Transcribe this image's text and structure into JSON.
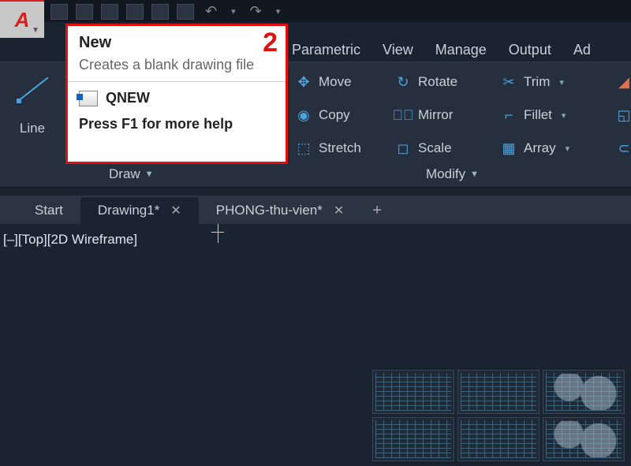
{
  "app": {
    "logo_letter": "A"
  },
  "menu": {
    "parametric": "Parametric",
    "view": "View",
    "manage": "Manage",
    "output": "Output",
    "addins": "Ad"
  },
  "tooltip": {
    "title": "New",
    "desc": "Creates a blank drawing file",
    "cmd": "QNEW",
    "help": "Press F1 for more help",
    "callout": "2"
  },
  "draw": {
    "line": "Line",
    "group": "Draw"
  },
  "modify": {
    "move": "Move",
    "rotate": "Rotate",
    "trim": "Trim",
    "copy": "Copy",
    "mirror": "Mirror",
    "fillet": "Fillet",
    "stretch": "Stretch",
    "scale": "Scale",
    "array": "Array",
    "group": "Modify"
  },
  "tabs": {
    "start": "Start",
    "drawing1": "Drawing1*",
    "phong": "PHONG-thu-vien*",
    "add": "+"
  },
  "viewport": {
    "label": "[–][Top][2D Wireframe]"
  }
}
